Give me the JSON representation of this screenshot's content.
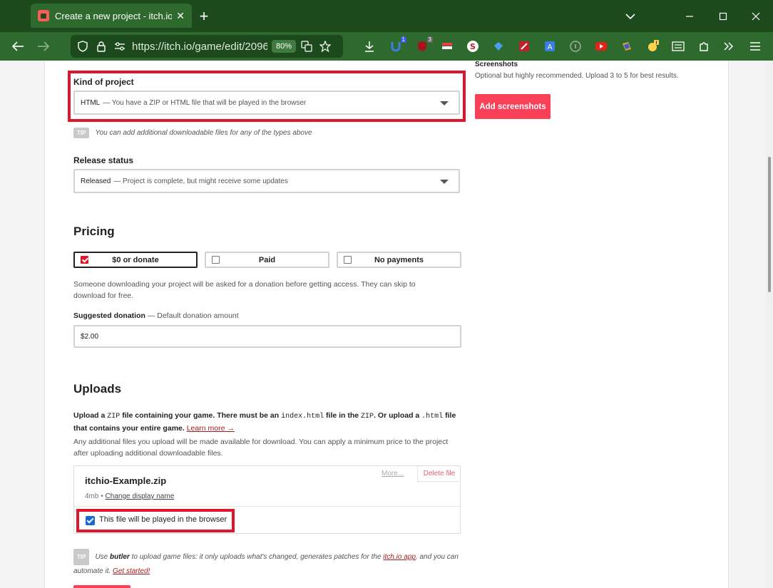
{
  "browser": {
    "tab_title": "Create a new project - itch.io",
    "tab_close": "✕",
    "new_tab": "+",
    "url": "https://itch.io/game/edit/2096",
    "zoom": "80%",
    "extension_badges": [
      "1",
      "3"
    ]
  },
  "form": {
    "kind_label": "Kind of project",
    "kind_value": "HTML",
    "kind_desc": "— You have a ZIP or HTML file that will be played in the browser",
    "kind_tip_badge": "TIP",
    "kind_tip": "You can add additional downloadable files for any of the types above",
    "release_label": "Release status",
    "release_value": "Released",
    "release_desc": "— Project is complete, but might receive some updates"
  },
  "pricing": {
    "title": "Pricing",
    "options": [
      {
        "label": "$0 or donate",
        "selected": true
      },
      {
        "label": "Paid",
        "selected": false
      },
      {
        "label": "No payments",
        "selected": false
      }
    ],
    "description": "Someone downloading your project will be asked for a donation before getting access. They can skip to download for free.",
    "suggested_label": "Suggested donation",
    "suggested_sub": "— Default donation amount",
    "suggested_value": "$2.00"
  },
  "uploads": {
    "title": "Uploads",
    "intro_1": "Upload a",
    "intro_zip": "ZIP",
    "intro_2": "file containing your game. There must be an",
    "intro_index": "index.html",
    "intro_3": "file in the",
    "intro_zip2": "ZIP",
    "intro_4": ". Or upload a",
    "intro_html": ".html",
    "intro_5": "file that contains your entire game.",
    "learn_more": "Learn more →",
    "additional": "Any additional files you upload will be made available for download. You can apply a minimum price to the project after uploading additional downloadable files.",
    "file": {
      "name": "itchio-Example.zip",
      "size": "4mb",
      "separator": "•",
      "change_name": "Change display name",
      "more": "More...",
      "delete": "Delete file",
      "browser_label": "This file will be played in the browser"
    },
    "tip_badge": "TIP",
    "tip_1": "Use",
    "tip_butler": "butler",
    "tip_2": "to upload game files: it only uploads what's changed, generates patches for the",
    "tip_app": "itch.io app",
    "tip_3": ", and you can automate it.",
    "tip_start": "Get started!"
  },
  "sidebar": {
    "screenshots_title": "Screenshots",
    "screenshots_hint": "Optional but highly recommended. Upload 3 to 5 for best results.",
    "add_button": "Add screenshots"
  },
  "colors": {
    "chrome_dark": "#1c4a1c",
    "chrome": "#2e6a2e",
    "accent": "#fa3f58",
    "highlight": "#e0142a",
    "checkbox": "#1a66d6"
  }
}
